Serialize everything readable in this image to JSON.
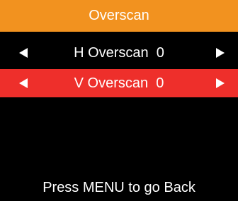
{
  "menu": {
    "title": "Overscan",
    "items": [
      {
        "label": "H Overscan",
        "value": "0",
        "selected": false
      },
      {
        "label": "V Overscan",
        "value": "0",
        "selected": true
      }
    ]
  },
  "footer": {
    "hint": "Press MENU to go Back"
  },
  "colors": {
    "title_bg": "#f2921f",
    "selected_bg": "#ee2f2b",
    "background": "#000000",
    "text": "#ffffff"
  },
  "icons": {
    "left": "left-triangle-icon",
    "right": "right-triangle-icon"
  }
}
